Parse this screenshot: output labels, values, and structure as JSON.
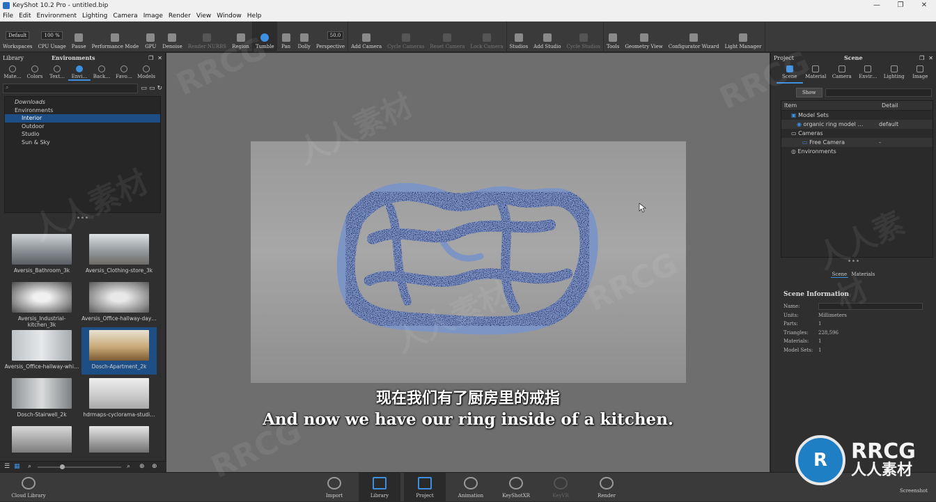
{
  "window": {
    "title": "KeyShot 10.2 Pro - untitled.bip",
    "controls": [
      "—",
      "❐",
      "✕"
    ]
  },
  "menu": [
    "File",
    "Edit",
    "Environment",
    "Lighting",
    "Camera",
    "Image",
    "Render",
    "View",
    "Window",
    "Help"
  ],
  "toolbar": {
    "workspace_value": "Default",
    "cpu_value": "100 %",
    "focal_value": "50.0",
    "buttons": [
      {
        "label": "Workspaces",
        "state": "normal"
      },
      {
        "label": "CPU Usage",
        "state": "normal"
      },
      {
        "label": "Pause",
        "state": "normal"
      },
      {
        "label": "Performance Mode",
        "state": "normal"
      },
      {
        "label": "GPU",
        "state": "normal"
      },
      {
        "label": "Denoise",
        "state": "normal"
      },
      {
        "label": "Render NURBS",
        "state": "dim"
      },
      {
        "label": "Region",
        "state": "normal"
      },
      {
        "label": "Tumble",
        "state": "active"
      },
      {
        "label": "Pan",
        "state": "normal"
      },
      {
        "label": "Dolly",
        "state": "normal"
      },
      {
        "label": "Perspective",
        "state": "normal"
      },
      {
        "label": "Add Camera",
        "state": "normal"
      },
      {
        "label": "Cycle Cameras",
        "state": "dim"
      },
      {
        "label": "Reset Camera",
        "state": "dim"
      },
      {
        "label": "Lock Camera",
        "state": "dim"
      },
      {
        "label": "Studios",
        "state": "normal"
      },
      {
        "label": "Add Studio",
        "state": "normal"
      },
      {
        "label": "Cycle Studios",
        "state": "dim"
      },
      {
        "label": "Tools",
        "state": "normal"
      },
      {
        "label": "Geometry View",
        "state": "normal"
      },
      {
        "label": "Configurator Wizard",
        "state": "normal"
      },
      {
        "label": "Light Manager",
        "state": "normal"
      }
    ]
  },
  "library": {
    "title": "Library",
    "panel_title": "Environments",
    "tabs": [
      {
        "label": "Mate…",
        "active": false
      },
      {
        "label": "Colors",
        "active": false
      },
      {
        "label": "Text…",
        "active": false
      },
      {
        "label": "Envi…",
        "active": true
      },
      {
        "label": "Back…",
        "active": false
      },
      {
        "label": "Favo…",
        "active": false
      },
      {
        "label": "Models",
        "active": false
      }
    ],
    "tree": [
      {
        "label": "Downloads",
        "indent": 0,
        "italic": true,
        "selected": false
      },
      {
        "label": "Environments",
        "indent": 0,
        "italic": false,
        "selected": false
      },
      {
        "label": "Interior",
        "indent": 1,
        "italic": false,
        "selected": true
      },
      {
        "label": "Outdoor",
        "indent": 1,
        "italic": false,
        "selected": false
      },
      {
        "label": "Studio",
        "indent": 1,
        "italic": false,
        "selected": false
      },
      {
        "label": "Sun & Sky",
        "indent": 1,
        "italic": false,
        "selected": false
      }
    ],
    "thumbnails": [
      {
        "label": "Aversis_Bathroom_3k",
        "selected": false
      },
      {
        "label": "Aversis_Clothing-store_3k",
        "selected": false
      },
      {
        "label": "Aversis_Industrial-kitchen_3k",
        "selected": false
      },
      {
        "label": "Aversis_Office-hallway-day…",
        "selected": false
      },
      {
        "label": "Aversis_Office-hallway-whi…",
        "selected": false
      },
      {
        "label": "Dosch-Apartment_2k",
        "selected": true
      },
      {
        "label": "Dosch-Stairwell_2k",
        "selected": false
      },
      {
        "label": "hdrmaps-cyclorama-studi…",
        "selected": false
      },
      {
        "label": "",
        "selected": false
      },
      {
        "label": "",
        "selected": false
      }
    ]
  },
  "viewport": {
    "subtitle_cn": "现在我们有了厨房里的戒指",
    "subtitle_en": "And now we have our ring inside of a kitchen."
  },
  "scene": {
    "project_title": "Project",
    "panel_title": "Scene",
    "tabs": [
      {
        "label": "Scene",
        "active": true
      },
      {
        "label": "Material",
        "active": false
      },
      {
        "label": "Camera",
        "active": false
      },
      {
        "label": "Envir…",
        "active": false
      },
      {
        "label": "Lighting",
        "active": false
      },
      {
        "label": "Image",
        "active": false
      }
    ],
    "show_label": "Show",
    "columns": [
      "Item",
      "Detail"
    ],
    "rows": [
      {
        "item": "Model Sets",
        "detail": "",
        "indent": 1,
        "highlight": false
      },
      {
        "item": "organic ring model …",
        "detail": "default",
        "indent": 2,
        "highlight": true
      },
      {
        "item": "Cameras",
        "detail": "",
        "indent": 1,
        "highlight": false
      },
      {
        "item": "Free Camera",
        "detail": "-",
        "indent": 2,
        "highlight": true
      },
      {
        "item": "Environments",
        "detail": "",
        "indent": 1,
        "highlight": false
      }
    ],
    "bottom_tabs": [
      "Scene",
      "Materials"
    ],
    "info": {
      "heading": "Scene Information",
      "name_label": "Name:",
      "rows": [
        {
          "k": "Units:",
          "v": "Millimeters"
        },
        {
          "k": "Parts:",
          "v": "1"
        },
        {
          "k": "Triangles:",
          "v": "228,596"
        },
        {
          "k": "Materials:",
          "v": "1"
        },
        {
          "k": "Model Sets:",
          "v": "1"
        }
      ]
    }
  },
  "bottombar": {
    "cloud_library": "Cloud Library",
    "buttons": [
      {
        "label": "Import",
        "state": "normal"
      },
      {
        "label": "Library",
        "state": "active"
      },
      {
        "label": "Project",
        "state": "active"
      },
      {
        "label": "Animation",
        "state": "normal"
      },
      {
        "label": "KeyShotXR",
        "state": "normal"
      },
      {
        "label": "KeyVR",
        "state": "dim"
      },
      {
        "label": "Render",
        "state": "normal"
      }
    ],
    "screenshot": "Screenshot"
  },
  "watermark": {
    "latin": "RRCG",
    "cn": "人人素材"
  },
  "colors": {
    "accent": "#3d8fe0",
    "selection": "#1d4f86",
    "ring": "#7d95c4"
  }
}
